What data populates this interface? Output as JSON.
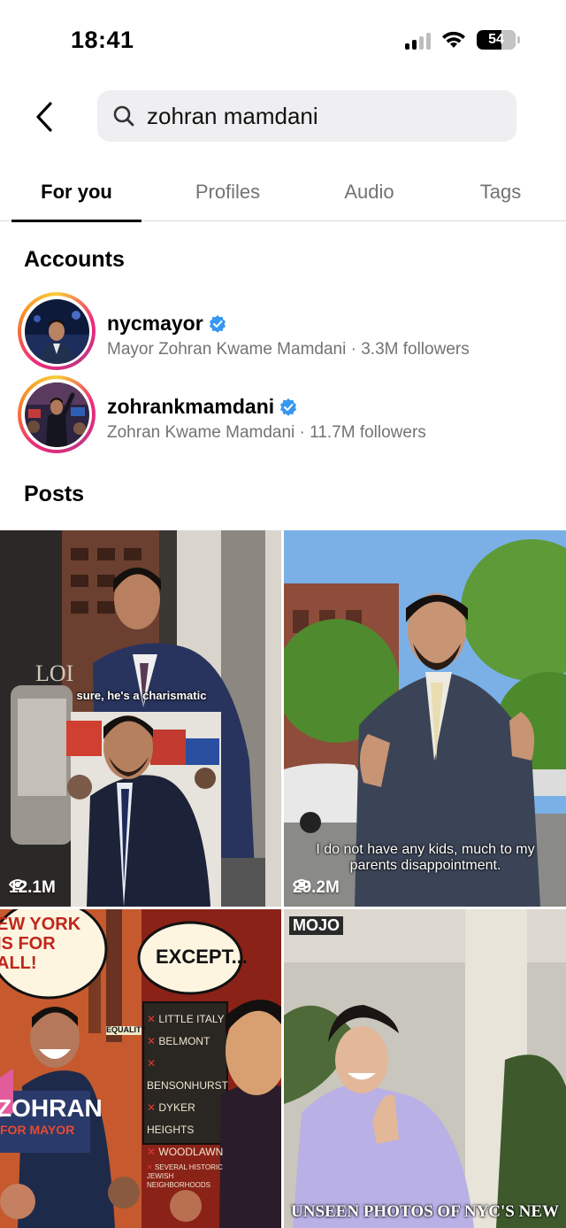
{
  "status_bar": {
    "time": "18:41",
    "battery": "54"
  },
  "search": {
    "query": "zohran mamdani"
  },
  "tabs": [
    {
      "label": "For you",
      "active": true
    },
    {
      "label": "Profiles",
      "active": false
    },
    {
      "label": "Audio",
      "active": false
    },
    {
      "label": "Tags",
      "active": false
    }
  ],
  "accounts_section": {
    "title": "Accounts"
  },
  "accounts": [
    {
      "username": "nycmayor",
      "verified": true,
      "full_name": "Mayor Zohran Kwame Mamdani",
      "followers": "3.3M followers"
    },
    {
      "username": "zohrankmamdani",
      "verified": true,
      "full_name": "Zohran Kwame Mamdani",
      "followers": "11.7M followers"
    }
  ],
  "posts_section": {
    "title": "Posts"
  },
  "posts": [
    {
      "views": "12.1M",
      "caption": "sure, he's a charismatic"
    },
    {
      "views": "29.2M",
      "caption": "I do not have any kids, much to my parents disappointment."
    },
    {
      "views": "",
      "caption": "EW YORK IS FOR ALL!",
      "poster_title": "ZOHRAN",
      "poster_sub": "FOR MAYOR",
      "bubble": "EXCEPT...",
      "list": [
        "LITTLE ITALY",
        "BELMONT",
        "BENSONHURST",
        "DYKER HEIGHTS",
        "WOODLAWN",
        "SEVERAL HISTORIC JEWISH NEIGHBORHOODS"
      ],
      "side_label": "EQUALITY"
    },
    {
      "views": "",
      "caption": "UNSEEN PHOTOS OF NYC'S NEW",
      "brand": "MOJO"
    }
  ],
  "colors": {
    "verified": "#3897f0",
    "tab_active": "#000000",
    "tab_inactive": "#737373",
    "search_bg": "#efeff1"
  }
}
